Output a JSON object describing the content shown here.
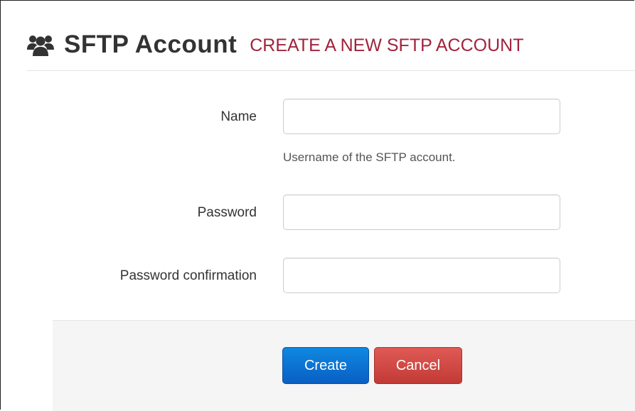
{
  "header": {
    "icon": "users-icon",
    "title": "SFTP Account",
    "subtitle": "CREATE A NEW SFTP ACCOUNT",
    "subtitle_color": "#a1233d"
  },
  "form": {
    "name": {
      "label": "Name",
      "value": "",
      "help": "Username of the SFTP account."
    },
    "password": {
      "label": "Password",
      "value": ""
    },
    "password_confirmation": {
      "label": "Password confirmation",
      "value": ""
    }
  },
  "actions": {
    "create_label": "Create",
    "cancel_label": "Cancel",
    "create_color": "#0a6fd1",
    "cancel_color": "#d24a45"
  }
}
